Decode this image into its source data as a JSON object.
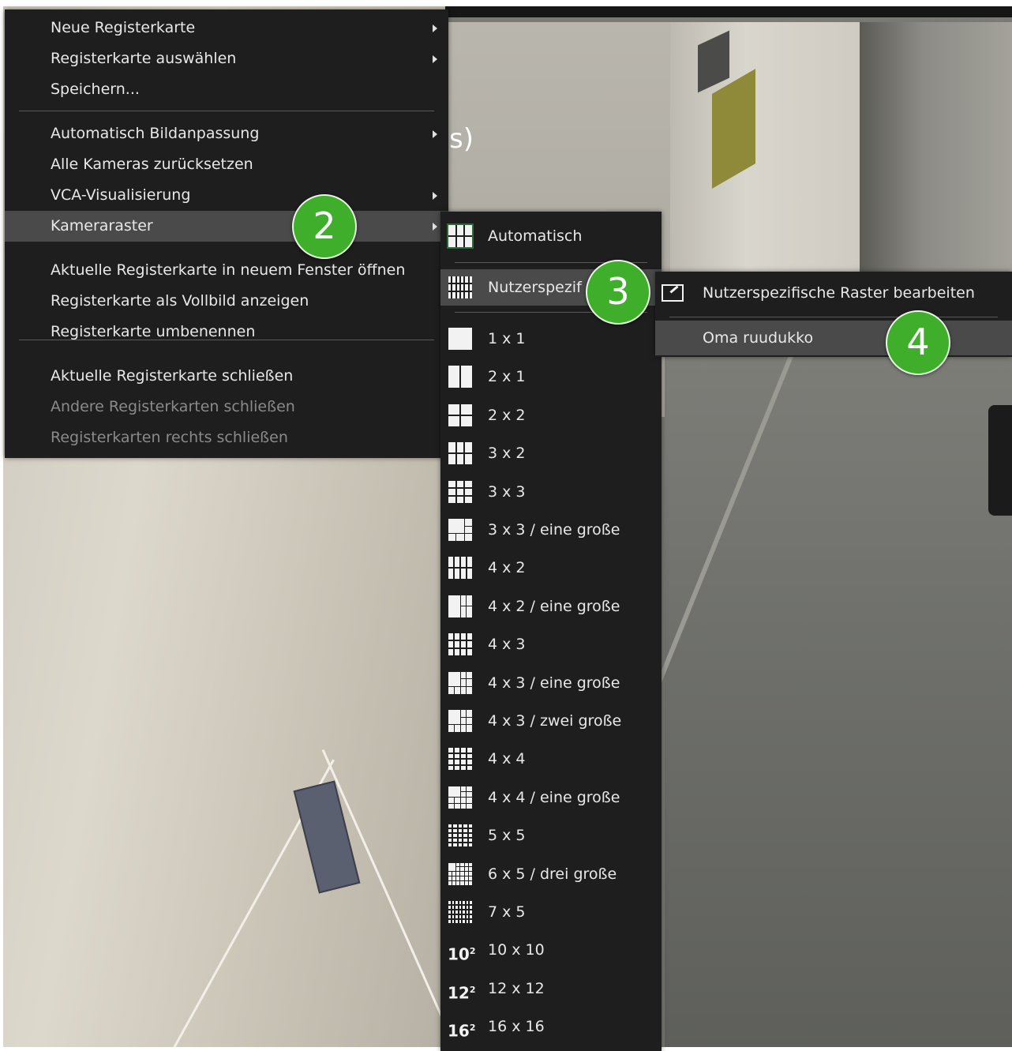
{
  "background": {
    "snippet_text": "s)"
  },
  "main_menu": {
    "items": [
      {
        "label": "Neue Registerkarte",
        "submenu": true,
        "state": "normal"
      },
      {
        "label": "Registerkarte auswählen",
        "submenu": true,
        "state": "normal"
      },
      {
        "label": "Speichern...",
        "submenu": false,
        "state": "normal"
      },
      {
        "label": "Automatisch Bildanpassung",
        "submenu": true,
        "state": "normal"
      },
      {
        "label": "Alle Kameras zurücksetzen",
        "submenu": false,
        "state": "normal"
      },
      {
        "label": "VCA-Visualisierung",
        "submenu": true,
        "state": "normal"
      },
      {
        "label": "Kameraraster",
        "submenu": true,
        "state": "highlighted"
      },
      {
        "label": "Aktuelle Registerkarte in neuem Fenster öffnen",
        "submenu": false,
        "state": "normal"
      },
      {
        "label": "Registerkarte als Vollbild anzeigen",
        "submenu": false,
        "state": "normal"
      },
      {
        "label": "Registerkarte umbenennen",
        "submenu": false,
        "state": "normal"
      },
      {
        "label": "Aktuelle Registerkarte schließen",
        "submenu": false,
        "state": "normal"
      },
      {
        "label": "Andere Registerkarten schließen",
        "submenu": false,
        "state": "disabled"
      },
      {
        "label": "Registerkarten rechts schließen",
        "submenu": false,
        "state": "disabled"
      }
    ]
  },
  "grid_menu": {
    "automatic": {
      "label": "Automatisch",
      "icon": "auto-grid-icon"
    },
    "custom": {
      "label": "Nutzerspezif",
      "icon": "custom-grid-icon",
      "state": "highlighted"
    },
    "layouts": [
      {
        "label": "1 x 1",
        "icon": "grid-1x1-icon"
      },
      {
        "label": "2 x 1",
        "icon": "grid-2x1-icon"
      },
      {
        "label": "2 x 2",
        "icon": "grid-2x2-icon"
      },
      {
        "label": "3 x 2",
        "icon": "grid-3x2-icon"
      },
      {
        "label": "3 x 3",
        "icon": "grid-3x3-icon"
      },
      {
        "label": "3 x 3 / eine große",
        "icon": "grid-3x3-one-large-icon"
      },
      {
        "label": "4 x 2",
        "icon": "grid-4x2-icon"
      },
      {
        "label": "4 x 2 / eine große",
        "icon": "grid-4x2-one-large-icon"
      },
      {
        "label": "4 x 3",
        "icon": "grid-4x3-icon"
      },
      {
        "label": "4 x 3 / eine große",
        "icon": "grid-4x3-one-large-icon"
      },
      {
        "label": "4 x 3 / zwei große",
        "icon": "grid-4x3-two-large-icon"
      },
      {
        "label": "4 x 4",
        "icon": "grid-4x4-icon"
      },
      {
        "label": "4 x 4 / eine große",
        "icon": "grid-4x4-one-large-icon"
      },
      {
        "label": "5 x 5",
        "icon": "grid-5x5-icon"
      },
      {
        "label": "6 x 5 / drei große",
        "icon": "grid-6x5-three-large-icon"
      },
      {
        "label": "7 x 5",
        "icon": "grid-7x5-icon"
      },
      {
        "label": "10 x 10",
        "icon": "grid-10x10-icon",
        "power": "10",
        "exp": "2"
      },
      {
        "label": "12 x 12",
        "icon": "grid-12x12-icon",
        "power": "12",
        "exp": "2"
      },
      {
        "label": "16 x 16",
        "icon": "grid-16x16-icon",
        "power": "16",
        "exp": "2"
      }
    ]
  },
  "custom_menu": {
    "edit": {
      "label": "Nutzerspezifische Raster bearbeiten",
      "icon": "edit-grid-icon"
    },
    "entries": [
      {
        "label": "Oma ruudukko",
        "state": "highlighted"
      }
    ]
  },
  "badges": [
    "2",
    "3",
    "4"
  ],
  "colors": {
    "menu_bg": "#1e1e1e",
    "menu_highlight": "#4a4a4a",
    "disabled_text": "#8a8a8a",
    "badge_green": "#3fae2a"
  }
}
